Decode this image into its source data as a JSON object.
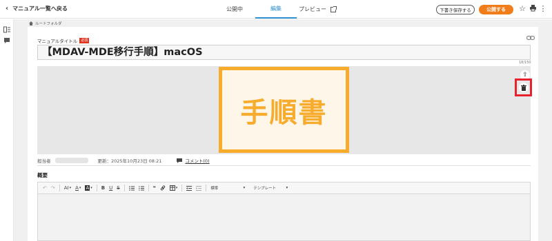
{
  "header": {
    "back_label": "マニュアル一覧へ戻る",
    "tabs": [
      {
        "label": "公開中"
      },
      {
        "label": "編集"
      },
      {
        "label": "プレビュー"
      }
    ],
    "draft_button": "下書き保存する",
    "publish_button": "公開する"
  },
  "breadcrumb": {
    "label": "ルートフォルダ"
  },
  "manual": {
    "title_label": "マニュアルタイトル",
    "required_badge": "必須",
    "title_value": "【MDAV-MDE移行手順】macOS",
    "char_count": "18/150",
    "hero_text": "手順書"
  },
  "meta": {
    "owner_label": "担当者",
    "updated": "更新：2025年10月23日 08:21",
    "comment": "コメント(0)"
  },
  "summary": {
    "label": "概要",
    "toolbar": {
      "undo": "↶",
      "redo": "↷",
      "font_size": "AI",
      "font_color": "A",
      "bg_color": "A",
      "bold": "B",
      "underline": "U",
      "strike": "S",
      "quote": "❝",
      "style_select": "標準",
      "template_select": "テンプレート"
    }
  },
  "colors": {
    "accent": "#f07c1a",
    "tab_active": "#2b8fd6",
    "hero_orange": "#f7ac2e",
    "highlight_red": "#e8212f",
    "required_red": "#e0341f"
  },
  "icons": [
    "back-chevron-icon",
    "external-link-icon",
    "star-icon",
    "print-icon",
    "more-vertical-icon",
    "toc-icon",
    "comment-icon",
    "home-icon",
    "link-icon",
    "upload-icon",
    "trash-icon"
  ]
}
